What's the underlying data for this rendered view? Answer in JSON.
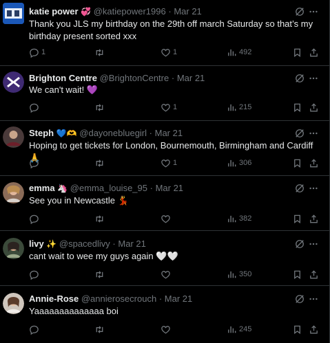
{
  "tweets": [
    {
      "name": "katie power",
      "badge": "💞",
      "handle": "@katiepower1996",
      "date": "Mar 21",
      "text": "Thank you JLS my birthday on the 29th off march  Saturday so that’s my birthday present sorted xxx",
      "replies": "1",
      "reposts": "",
      "likes": "1",
      "views": "492"
    },
    {
      "name": "Brighton Centre",
      "badge": "",
      "handle": "@BrightonCentre",
      "date": "Mar 21",
      "text": "We can't wait! 💜",
      "replies": "",
      "reposts": "",
      "likes": "1",
      "views": "215"
    },
    {
      "name": "Steph",
      "badge": "💙🫶",
      "handle": "@dayonebluegirl",
      "date": "Mar 21",
      "text": "Hoping to get tickets for London, Bournemouth, Birmingham and Cardiff 🙏",
      "replies": "",
      "reposts": "",
      "likes": "1",
      "views": "306"
    },
    {
      "name": "emma",
      "badge": "🦄",
      "handle": "@emma_louise_95",
      "date": "Mar 21",
      "text": "See you in Newcastle 💃",
      "replies": "",
      "reposts": "",
      "likes": "",
      "views": "382"
    },
    {
      "name": "livy",
      "badge": "✨",
      "handle": "@spacedlivy",
      "date": "Mar 21",
      "text": "cant wait to wee my guys again 🤍🤍",
      "replies": "",
      "reposts": "",
      "likes": "",
      "views": "350"
    },
    {
      "name": "Annie-Rose",
      "badge": "",
      "handle": "@annierosecrouch",
      "date": "Mar 21",
      "text": "Yaaaaaaaaaaaaaa boi",
      "replies": "",
      "reposts": "",
      "likes": "",
      "views": "245"
    }
  ],
  "separator": "·",
  "icons": [
    "reply-icon",
    "repost-icon",
    "like-icon",
    "views-icon",
    "bookmark-icon",
    "share-icon",
    "grok-icon",
    "more-icon"
  ]
}
